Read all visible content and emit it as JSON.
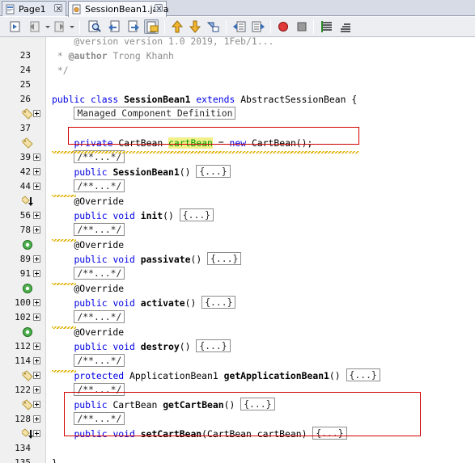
{
  "tabs": [
    {
      "label": "Page1",
      "active": false
    },
    {
      "label": "SessionBean1.java",
      "active": true
    }
  ],
  "toolbar": {
    "icons": [
      "toggle-bookmark-icon",
      "navigate-back-icon",
      "navigate-forward-icon",
      "find-icon",
      "find-previous-icon",
      "find-next-icon",
      "highlight-toggle-icon",
      "previous-bookmark-icon",
      "next-bookmark-icon",
      "toggle-rectangle-icon",
      "shift-left-icon",
      "shift-right-icon",
      "start-macro-icon",
      "stop-macro-icon",
      "comment-icon",
      "uncomment-icon"
    ]
  },
  "lines": [
    {
      "num": "",
      "parts": [
        {
          "t": "    @version version 1.0 2019, 1Feb/1...",
          "c": "cm"
        }
      ]
    },
    {
      "num": "23",
      "parts": [
        {
          "t": " * ",
          "c": "cm"
        },
        {
          "t": "@author",
          "c": "cm bold"
        },
        {
          "t": " Trong Khanh",
          "c": "cm"
        }
      ]
    },
    {
      "num": "24",
      "parts": [
        {
          "t": " */",
          "c": "cm"
        }
      ]
    },
    {
      "num": "25",
      "parts": []
    },
    {
      "num": "26",
      "parts": [
        {
          "t": "public class ",
          "c": "kw"
        },
        {
          "t": "SessionBean1 ",
          "c": "bold"
        },
        {
          "t": "extends ",
          "c": "kw"
        },
        {
          "t": "AbstractSessionBean {",
          "c": ""
        }
      ]
    },
    {
      "num": "",
      "fold": true,
      "icon": "tag",
      "parts": [
        {
          "t": "    ",
          "c": ""
        },
        {
          "t": "Managed Component Definition",
          "c": "foldbox"
        }
      ]
    },
    {
      "num": "37",
      "parts": []
    },
    {
      "num": "",
      "icon": "tag",
      "parts": [
        {
          "t": "    ",
          "c": ""
        },
        {
          "t": "private ",
          "c": "kw"
        },
        {
          "t": "CartBean ",
          "c": ""
        },
        {
          "t": "cartBean",
          "c": "field"
        },
        {
          "t": " = ",
          "c": ""
        },
        {
          "t": "new ",
          "c": "kw"
        },
        {
          "t": "CartBean();",
          "c": ""
        }
      ]
    },
    {
      "num": "39",
      "fold": true,
      "parts": [
        {
          "t": "    ",
          "c": ""
        },
        {
          "t": "/**...*/",
          "c": "foldbox"
        }
      ]
    },
    {
      "num": "42",
      "fold": true,
      "parts": [
        {
          "t": "    ",
          "c": ""
        },
        {
          "t": "public ",
          "c": "kw"
        },
        {
          "t": "SessionBean1",
          "c": "bold"
        },
        {
          "t": "() ",
          "c": ""
        },
        {
          "t": "{...}",
          "c": "foldbox"
        }
      ]
    },
    {
      "num": "44",
      "fold": true,
      "parts": [
        {
          "t": "    ",
          "c": ""
        },
        {
          "t": "/**...*/",
          "c": "foldbox"
        }
      ]
    },
    {
      "num": "",
      "icon": "tag-down",
      "parts": [
        {
          "t": "    @Override",
          "c": "ann"
        }
      ]
    },
    {
      "num": "56",
      "fold": true,
      "parts": [
        {
          "t": "    ",
          "c": ""
        },
        {
          "t": "public void ",
          "c": "kw"
        },
        {
          "t": "init",
          "c": "bold"
        },
        {
          "t": "() ",
          "c": ""
        },
        {
          "t": "{...}",
          "c": "foldbox"
        }
      ]
    },
    {
      "num": "78",
      "fold": true,
      "parts": [
        {
          "t": "    ",
          "c": ""
        },
        {
          "t": "/**...*/",
          "c": "foldbox"
        }
      ]
    },
    {
      "num": "",
      "icon": "override",
      "parts": [
        {
          "t": "    @Override",
          "c": "ann"
        }
      ]
    },
    {
      "num": "89",
      "fold": true,
      "parts": [
        {
          "t": "    ",
          "c": ""
        },
        {
          "t": "public void ",
          "c": "kw"
        },
        {
          "t": "passivate",
          "c": "bold"
        },
        {
          "t": "() ",
          "c": ""
        },
        {
          "t": "{...}",
          "c": "foldbox"
        }
      ]
    },
    {
      "num": "91",
      "fold": true,
      "parts": [
        {
          "t": "    ",
          "c": ""
        },
        {
          "t": "/**...*/",
          "c": "foldbox"
        }
      ]
    },
    {
      "num": "",
      "icon": "override",
      "parts": [
        {
          "t": "    @Override",
          "c": "ann"
        }
      ]
    },
    {
      "num": "100",
      "fold": true,
      "parts": [
        {
          "t": "    ",
          "c": ""
        },
        {
          "t": "public void ",
          "c": "kw"
        },
        {
          "t": "activate",
          "c": "bold"
        },
        {
          "t": "() ",
          "c": ""
        },
        {
          "t": "{...}",
          "c": "foldbox"
        }
      ]
    },
    {
      "num": "102",
      "fold": true,
      "parts": [
        {
          "t": "    ",
          "c": ""
        },
        {
          "t": "/**...*/",
          "c": "foldbox"
        }
      ]
    },
    {
      "num": "",
      "icon": "override",
      "parts": [
        {
          "t": "    @Override",
          "c": "ann"
        }
      ]
    },
    {
      "num": "112",
      "fold": true,
      "parts": [
        {
          "t": "    ",
          "c": ""
        },
        {
          "t": "public void ",
          "c": "kw"
        },
        {
          "t": "destroy",
          "c": "bold"
        },
        {
          "t": "() ",
          "c": ""
        },
        {
          "t": "{...}",
          "c": "foldbox"
        }
      ]
    },
    {
      "num": "114",
      "fold": true,
      "parts": [
        {
          "t": "    ",
          "c": ""
        },
        {
          "t": "/**...*/",
          "c": "foldbox"
        }
      ]
    },
    {
      "num": "",
      "fold": true,
      "icon": "tag",
      "parts": [
        {
          "t": "    ",
          "c": ""
        },
        {
          "t": "protected ",
          "c": "kw"
        },
        {
          "t": "ApplicationBean1 ",
          "c": ""
        },
        {
          "t": "getApplicationBean1",
          "c": "bold"
        },
        {
          "t": "() ",
          "c": ""
        },
        {
          "t": "{...}",
          "c": "foldbox"
        }
      ]
    },
    {
      "num": "122",
      "fold": true,
      "parts": [
        {
          "t": "    ",
          "c": ""
        },
        {
          "t": "/**...*/",
          "c": "foldbox"
        }
      ]
    },
    {
      "num": "",
      "fold": true,
      "icon": "tag",
      "parts": [
        {
          "t": "    ",
          "c": ""
        },
        {
          "t": "public ",
          "c": "kw"
        },
        {
          "t": "CartBean ",
          "c": ""
        },
        {
          "t": "getCartBean",
          "c": "bold"
        },
        {
          "t": "() ",
          "c": ""
        },
        {
          "t": "{...}",
          "c": "foldbox"
        }
      ]
    },
    {
      "num": "128",
      "fold": true,
      "parts": [
        {
          "t": "    ",
          "c": ""
        },
        {
          "t": "/**...*/",
          "c": "foldbox"
        }
      ]
    },
    {
      "num": "",
      "fold": true,
      "icon": "tag-down",
      "parts": [
        {
          "t": "    ",
          "c": ""
        },
        {
          "t": "public void ",
          "c": "kw"
        },
        {
          "t": "setCartBean",
          "c": "bold"
        },
        {
          "t": "(CartBean cartBean) ",
          "c": ""
        },
        {
          "t": "{...}",
          "c": "foldbox"
        }
      ]
    },
    {
      "num": "134",
      "parts": []
    },
    {
      "num": "135",
      "parts": [
        {
          "t": "}",
          "c": ""
        }
      ]
    }
  ],
  "colors": {
    "keyword": "#0000e6",
    "comment": "#8c8c8c",
    "field": "#009900",
    "field_bg": "#f1f08a",
    "highlight_box": "#d20000"
  }
}
